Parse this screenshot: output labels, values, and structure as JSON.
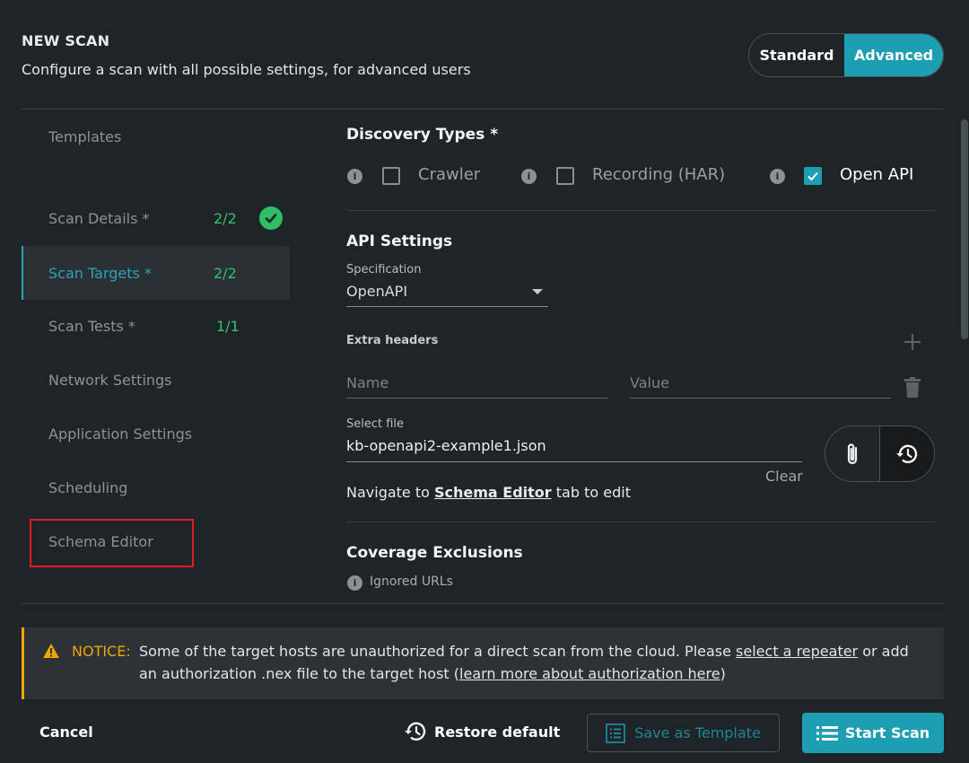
{
  "header": {
    "title": "NEW SCAN",
    "subtitle": "Configure a scan with all possible settings, for advanced users",
    "mode_standard": "Standard",
    "mode_advanced": "Advanced"
  },
  "sidebar": {
    "items": [
      {
        "label": "Templates",
        "count": ""
      },
      {
        "label": "Scan Details *",
        "count": "2/2"
      },
      {
        "label": "Scan Targets *",
        "count": "2/2"
      },
      {
        "label": "Scan Tests *",
        "count": "1/1"
      },
      {
        "label": "Network Settings",
        "count": ""
      },
      {
        "label": "Application Settings",
        "count": ""
      },
      {
        "label": "Scheduling",
        "count": ""
      },
      {
        "label": "Schema Editor",
        "count": ""
      }
    ],
    "active_index": 2
  },
  "discovery": {
    "heading": "Discovery Types *",
    "types": [
      {
        "label": "Crawler",
        "checked": false
      },
      {
        "label": "Recording (HAR)",
        "checked": false
      },
      {
        "label": "Open API",
        "checked": true
      }
    ]
  },
  "api_settings": {
    "heading": "API Settings",
    "spec_label": "Specification",
    "spec_value": "OpenAPI",
    "extra_headers_label": "Extra headers",
    "name_placeholder": "Name",
    "value_placeholder": "Value",
    "select_file_label": "Select file",
    "file_value": "kb-openapi2-example1.json",
    "clear_label": "Clear",
    "navigate_prefix": "Navigate to ",
    "navigate_link": "Schema Editor",
    "navigate_suffix": " tab to edit"
  },
  "coverage": {
    "heading": "Coverage Exclusions",
    "ignored_label": "Ignored URLs"
  },
  "notice": {
    "label": "NOTICE:",
    "line1_prefix": "Some of the target hosts are unauthorized for a direct scan from the cloud. Please ",
    "line1_link": "select a repeater",
    "line1_suffix": " or add",
    "line2_prefix": "an authorization .nex file to the target host (",
    "line2_link": "learn more about authorization here",
    "line2_suffix": ")"
  },
  "footer": {
    "cancel": "Cancel",
    "restore": "Restore default",
    "save_template": "Save as Template",
    "start_scan": "Start Scan"
  },
  "colors": {
    "accent": "#1d9eb1",
    "success": "#2fbe63",
    "warning": "#f0a500",
    "highlight": "#e01b24"
  }
}
